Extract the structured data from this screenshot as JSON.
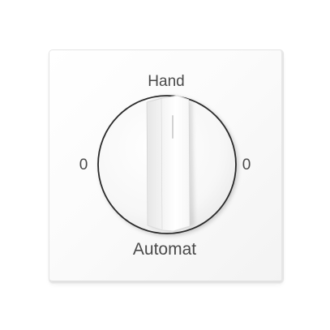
{
  "labels": {
    "top": "Hand",
    "bottom": "Automat",
    "left": "0",
    "right": "0"
  },
  "colors": {
    "plate": "#fafafa",
    "knob_outline": "#2a2a2a",
    "label_text": "#4a4a4a"
  },
  "icons": {
    "knob": "rotary-switch-knob"
  }
}
